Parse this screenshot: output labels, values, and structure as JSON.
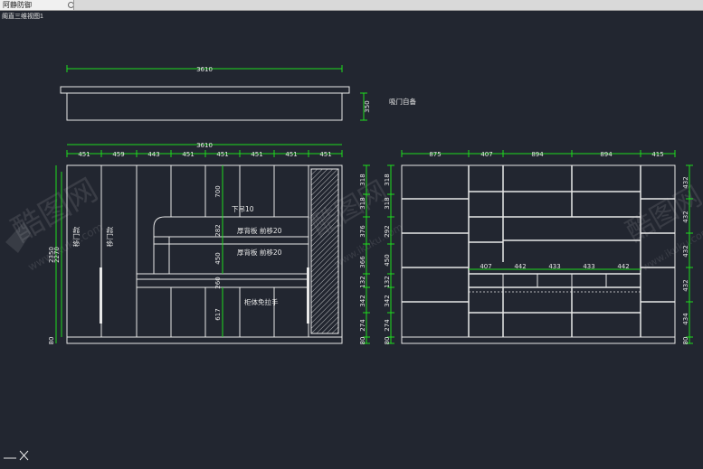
{
  "window": {
    "tab_title": "阿静防御",
    "sheet_label": "阁直三维视图1"
  },
  "colors": {
    "background": "#222630",
    "lines": "#e8e8e8",
    "dimension_lines": "#1edc1e"
  },
  "icons": {
    "ucs": "ucs-axes-icon",
    "watermark": "kukutu-logo-icon"
  },
  "top_view": {
    "overall_width": "3610",
    "depth": "350",
    "note": "吸门自备"
  },
  "left_elevation": {
    "overall_width": "3610",
    "top_segments": [
      "451",
      "459",
      "443",
      "451",
      "451",
      "451",
      "451",
      "451"
    ],
    "heights_left": [
      "2350",
      "2270",
      "80"
    ],
    "heights_right": [
      "318",
      "318",
      "376",
      "366",
      "132",
      "342",
      "274",
      "80"
    ],
    "inner_dims": [
      "700",
      "282",
      "450",
      "260",
      "617"
    ],
    "labels": {
      "ceiling": "下吊10",
      "thick_back_1": "厚背板 前移20",
      "thick_back_2": "厚背板 前移20",
      "no_handle": "柜体免拉手",
      "door_a": "移门款",
      "door_b": "移门款"
    }
  },
  "right_elevation": {
    "top_segments": [
      "875",
      "407",
      "894",
      "894",
      "415"
    ],
    "inner_segments": [
      "407",
      "442",
      "433",
      "433",
      "442"
    ],
    "heights_left": [
      "318",
      "318",
      "292",
      "450",
      "132",
      "342",
      "274",
      "80"
    ],
    "heights_right": [
      "432",
      "432",
      "432",
      "432",
      "434",
      "80"
    ]
  },
  "watermarks": [
    "酷图网",
    "www.ikuku.com"
  ]
}
